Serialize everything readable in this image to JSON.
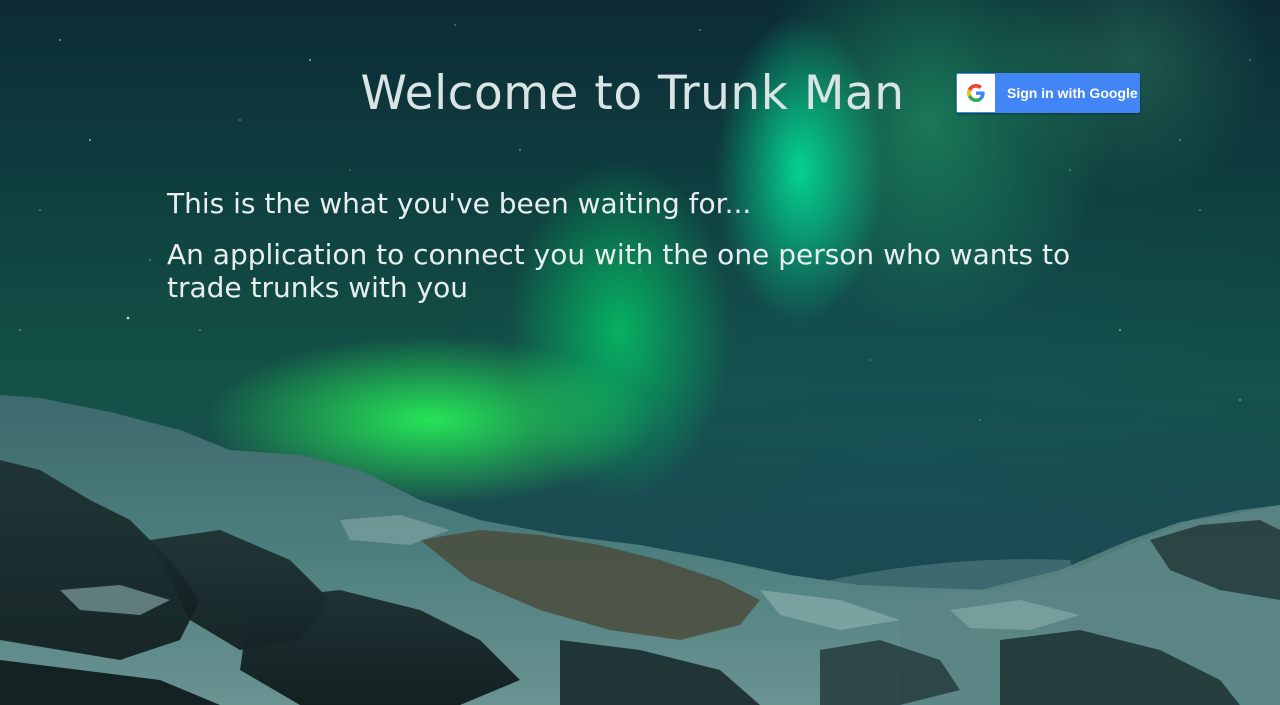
{
  "header": {
    "title": "Welcome to Trunk Man"
  },
  "auth": {
    "google_button_label": "Sign in with Google",
    "google_icon": "google-g-icon"
  },
  "content": {
    "intro": "This is the what you've been waiting for...",
    "description": "An application to connect you with the one person who wants to trade trunks with you"
  },
  "colors": {
    "google_blue": "#4285f4",
    "text": "#e8eeee"
  }
}
